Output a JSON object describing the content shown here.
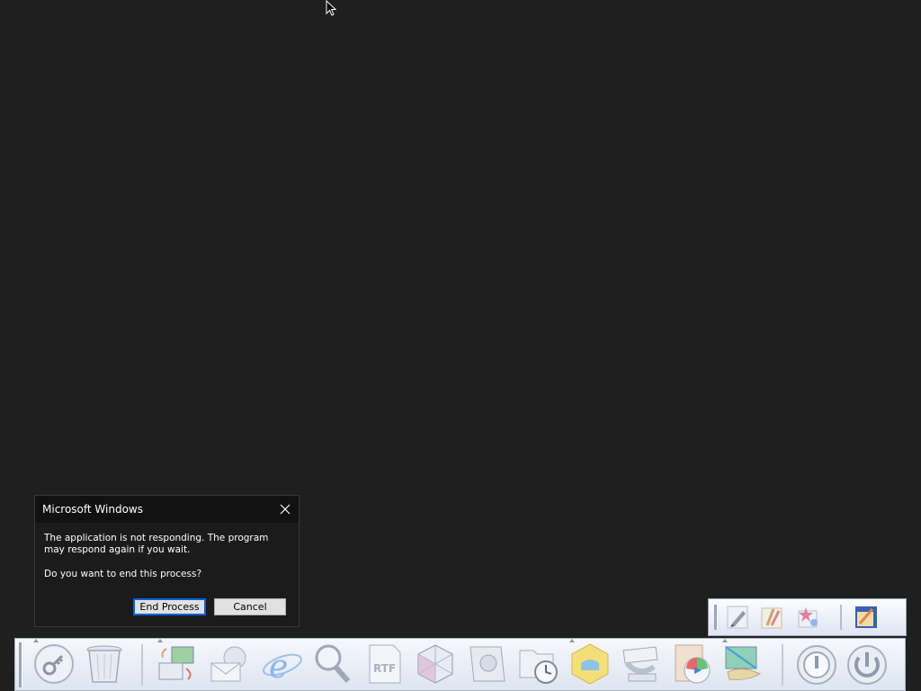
{
  "dialog": {
    "title": "Microsoft Windows",
    "message": "The application is not responding. The program may respond again if you wait.",
    "question": "Do you want to end this process?",
    "end_process_label": "End Process",
    "cancel_label": "Cancel"
  },
  "tray": {
    "icons": [
      "pen-tool-icon",
      "paint-brushes-icon",
      "shape-star-icon",
      "paint-program-icon"
    ]
  },
  "dock": {
    "icons": [
      "key-icon",
      "recycle-bin-icon",
      "network-transfer-icon",
      "mail-icon",
      "internet-explorer-icon",
      "search-icon",
      "rtf-document-icon",
      "3d-cube-icon",
      "hard-drive-icon",
      "scheduled-folder-icon",
      "package-icon",
      "scanner-icon",
      "media-player-icon",
      "display-settings-icon",
      "log-off-icon",
      "shutdown-icon"
    ]
  },
  "colors": {
    "accent": "#0a64d6",
    "desktop": "#1f1f1f",
    "dialog_bg": "#1b1b1b"
  }
}
